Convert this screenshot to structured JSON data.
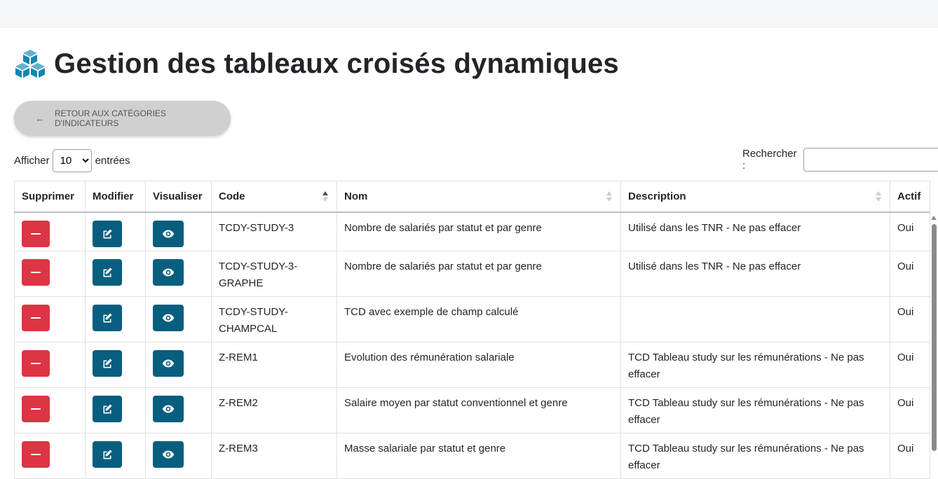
{
  "page": {
    "title": "Gestion des tableaux croisés dynamiques",
    "back_label": "RETOUR AUX CATÉGORIES D'INDICATEURS"
  },
  "controls": {
    "show_label": "Afficher",
    "length_value": "10",
    "entries_label": "entrées",
    "search_label": "Rechercher :",
    "search_value": ""
  },
  "table": {
    "headers": [
      "Supprimer",
      "Modifier",
      "Visualiser",
      "Code",
      "Nom",
      "Description",
      "Actif"
    ],
    "sorted_column": "Code",
    "rows": [
      {
        "code": "TCDY-STUDY-3",
        "nom": "Nombre de salariés par statut et par genre",
        "description": "Utilisé dans les TNR - Ne pas effacer",
        "actif": "Oui"
      },
      {
        "code": "TCDY-STUDY-3-GRAPHE",
        "nom": "Nombre de salariés par statut et par genre",
        "description": "Utilisé dans les TNR - Ne pas effacer",
        "actif": "Oui"
      },
      {
        "code": "TCDY-STUDY-CHAMPCAL",
        "nom": "TCD avec exemple de champ calculé",
        "description": "",
        "actif": "Oui"
      },
      {
        "code": "Z-REM1",
        "nom": "Evolution des rémunération salariale",
        "description": "TCD Tableau study sur les rémunérations - Ne pas effacer",
        "actif": "Oui"
      },
      {
        "code": "Z-REM2",
        "nom": "Salaire moyen par statut conventionnel et genre",
        "description": "TCD Tableau study sur les rémunérations - Ne pas effacer",
        "actif": "Oui"
      },
      {
        "code": "Z-REM3",
        "nom": "Masse salariale par statut et genre",
        "description": "TCD Tableau study sur les rémunérations - Ne pas effacer",
        "actif": "Oui"
      }
    ]
  },
  "colors": {
    "danger": "#dc3545",
    "primary": "#075e7e",
    "title_icon": "#0f86b4"
  },
  "icons": {
    "title": "cubes-icon",
    "back": "arrow-left-icon",
    "delete": "minus-icon",
    "edit": "edit-icon",
    "view": "eye-icon"
  }
}
